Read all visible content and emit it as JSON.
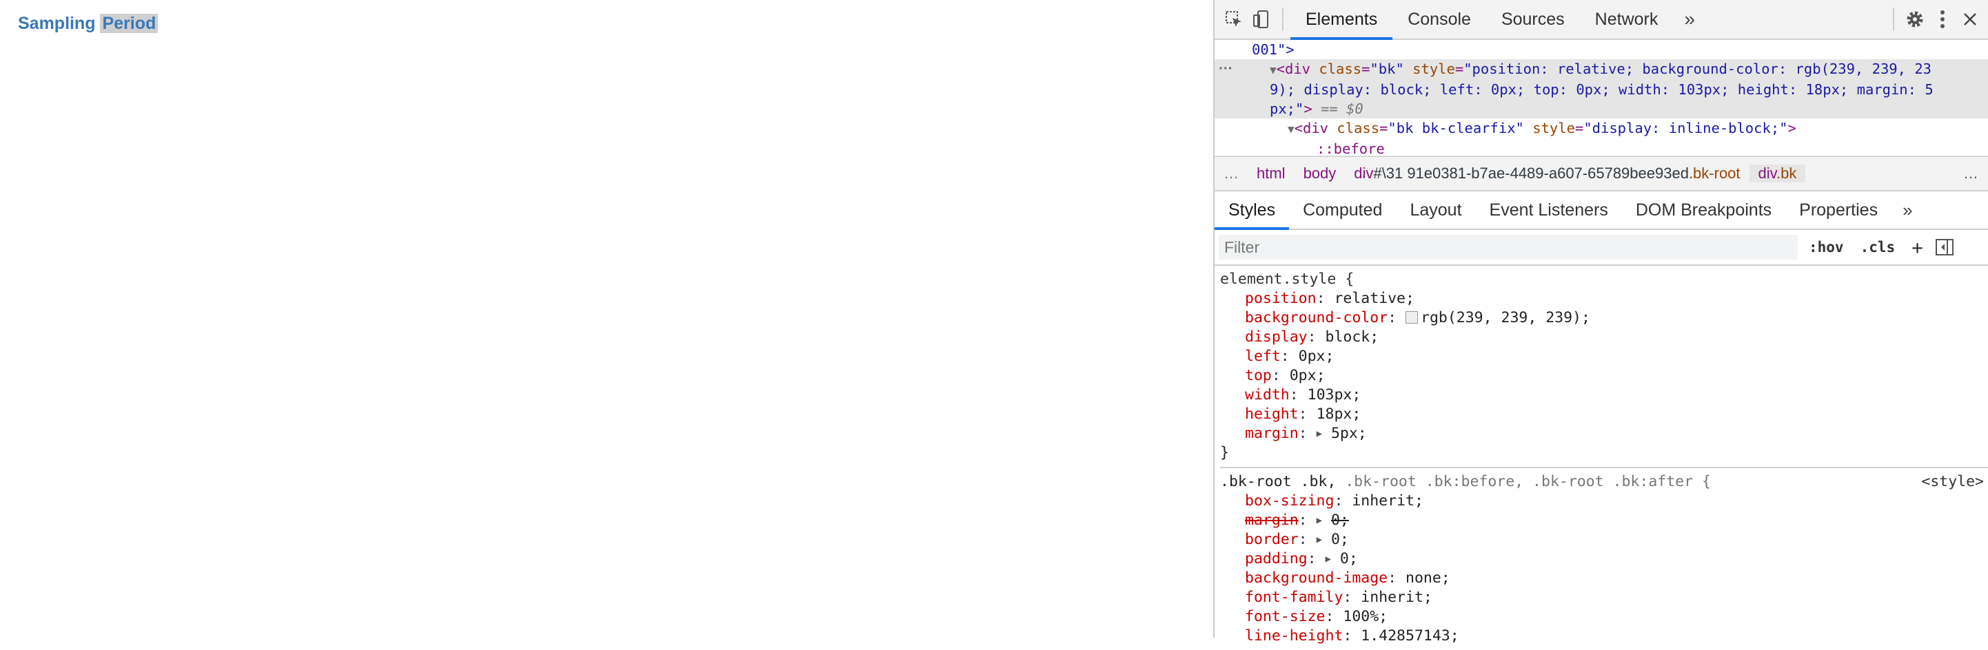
{
  "page": {
    "title_part1": "Sampling ",
    "title_part2": "Period"
  },
  "devtools": {
    "tabs": [
      "Elements",
      "Console",
      "Sources",
      "Network"
    ],
    "more_tabs": "»",
    "dom": {
      "line0": "001\">",
      "sel_open": "<div ",
      "sel_attr1": "class",
      "sel_val1": "\"bk\"",
      "sel_attr2": "style",
      "sel_val2a": "\"position: relative; background-color: rgb(239, 239, 23",
      "sel_val2b": "9); display: block; left: 0px; top: 0px; width: 103px; height: 18px; margin: 5",
      "sel_val2c": "px;\"",
      "sel_eq": " == $0",
      "child_open": "<div ",
      "child_attr1": "class",
      "child_val1": "\"bk bk-clearfix\"",
      "child_attr2": "style",
      "child_val2": "\"display: inline-block;\"",
      "child_close": ">",
      "pseudo": "::before"
    },
    "breadcrumbs": {
      "ellipsis": "…",
      "html": "html",
      "body": "body",
      "div_tag": "div",
      "div_id": "#\\31 91e0381-b7ae-4489-a607-65789bee93ed",
      "div_class": ".bk-root",
      "divbk_tag": "div",
      "divbk_class": ".bk"
    },
    "subtabs": [
      "Styles",
      "Computed",
      "Layout",
      "Event Listeners",
      "DOM Breakpoints",
      "Properties"
    ],
    "filter": {
      "placeholder": "Filter",
      "hov": ":hov",
      "cls": ".cls",
      "plus": "+"
    },
    "rules": {
      "element_selector": "element.style {",
      "element_decls": [
        {
          "name": "position",
          "value": "relative;"
        },
        {
          "name": "background-color",
          "value": "rgb(239, 239, 239);"
        },
        {
          "name": "display",
          "value": "block;"
        },
        {
          "name": "left",
          "value": "0px;"
        },
        {
          "name": "top",
          "value": "0px;"
        },
        {
          "name": "width",
          "value": "103px;"
        },
        {
          "name": "height",
          "value": "18px;"
        },
        {
          "name": "margin",
          "value": "5px;"
        }
      ],
      "close": "}",
      "rule2_selector_main": ".bk-root .bk,",
      "rule2_selector_rest": " .bk-root .bk:before, .bk-root .bk:after {",
      "rule2_origin": "<style>",
      "rule2_decls": [
        {
          "name": "box-sizing",
          "value": "inherit;"
        },
        {
          "name": "margin",
          "value": "0;"
        },
        {
          "name": "border",
          "value": "0;"
        },
        {
          "name": "padding",
          "value": "0;"
        },
        {
          "name": "background-image",
          "value": "none;"
        },
        {
          "name": "font-family",
          "value": "inherit;"
        },
        {
          "name": "font-size",
          "value": "100%;"
        },
        {
          "name": "line-height",
          "value": "1.42857143;"
        }
      ]
    }
  }
}
